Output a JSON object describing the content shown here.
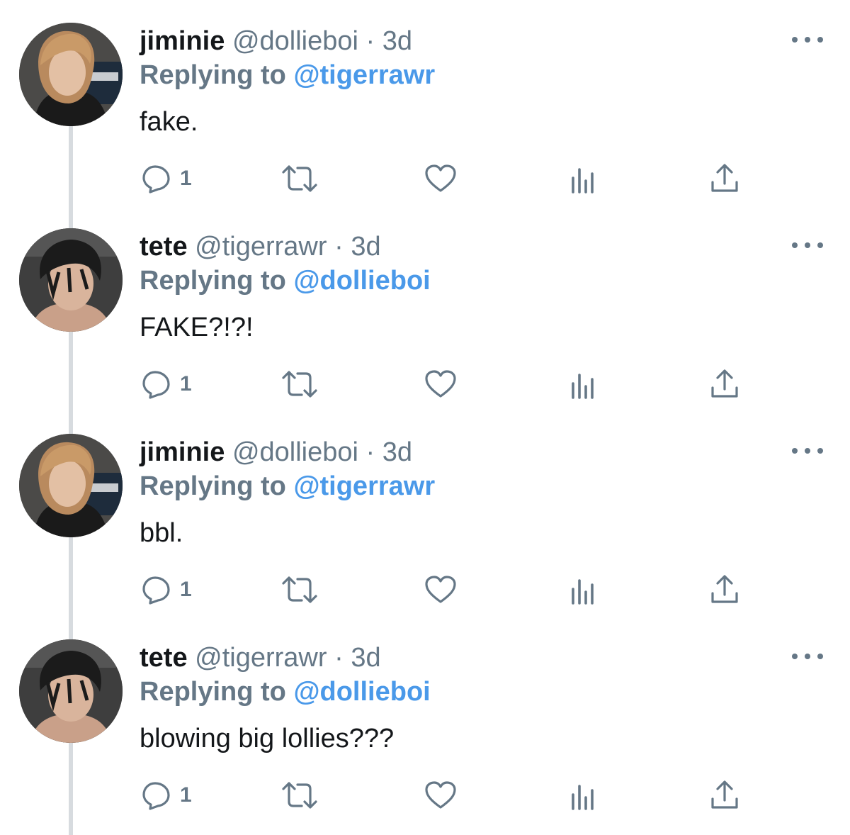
{
  "tweets": [
    {
      "display_name": "jiminie",
      "handle": "@dollieboi",
      "separator": "·",
      "time": "3d",
      "reply_prefix": "Replying to",
      "reply_to": "@tigerrawr",
      "text": "fake.",
      "reply_count": "1",
      "avatar": "jiminie-avatar"
    },
    {
      "display_name": "tete",
      "handle": "@tigerrawr",
      "separator": "·",
      "time": "3d",
      "reply_prefix": "Replying to",
      "reply_to": "@dollieboi",
      "text": "FAKE?!?!",
      "reply_count": "1",
      "avatar": "tete-avatar"
    },
    {
      "display_name": "jiminie",
      "handle": "@dollieboi",
      "separator": "·",
      "time": "3d",
      "reply_prefix": "Replying to",
      "reply_to": "@tigerrawr",
      "text": "bbl.",
      "reply_count": "1",
      "avatar": "jiminie-avatar"
    },
    {
      "display_name": "tete",
      "handle": "@tigerrawr",
      "separator": "·",
      "time": "3d",
      "reply_prefix": "Replying to",
      "reply_to": "@dollieboi",
      "text": "blowing big lollies???",
      "reply_count": "1",
      "avatar": "tete-avatar"
    }
  ],
  "icons": [
    "reply-icon",
    "retweet-icon",
    "like-icon",
    "analytics-icon",
    "share-icon",
    "more-icon"
  ],
  "colors": {
    "text": "#14171a",
    "muted": "#657786",
    "link": "#4a99e9",
    "thread_line": "#d7dbdf"
  }
}
